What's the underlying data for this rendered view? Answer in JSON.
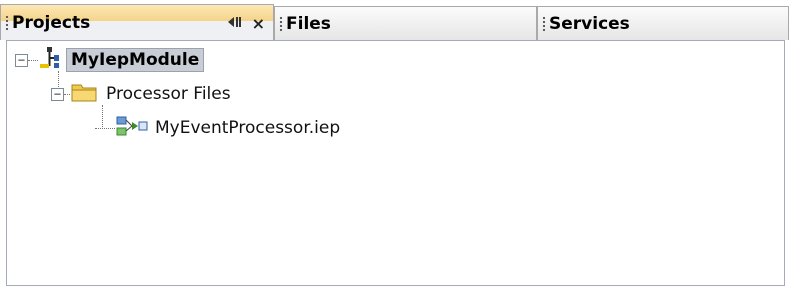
{
  "tabs": [
    {
      "label": "Projects",
      "active": true
    },
    {
      "label": "Files",
      "active": false
    },
    {
      "label": "Services",
      "active": false
    }
  ],
  "tab_controls": {
    "minimize_icon": "minimize-icon",
    "close_glyph": "×"
  },
  "tree": {
    "root": {
      "label": "MyIepModule",
      "toggle": "−",
      "icon": "project-icon"
    },
    "folder": {
      "label": "Processor Files",
      "toggle": "−",
      "icon": "folder-icon"
    },
    "file": {
      "label": "MyEventProcessor.iep",
      "icon": "event-processor-icon"
    }
  },
  "colors": {
    "active_tab": "#f4d48a",
    "selection": "#c9ced6",
    "folder": "#f2c94c"
  }
}
